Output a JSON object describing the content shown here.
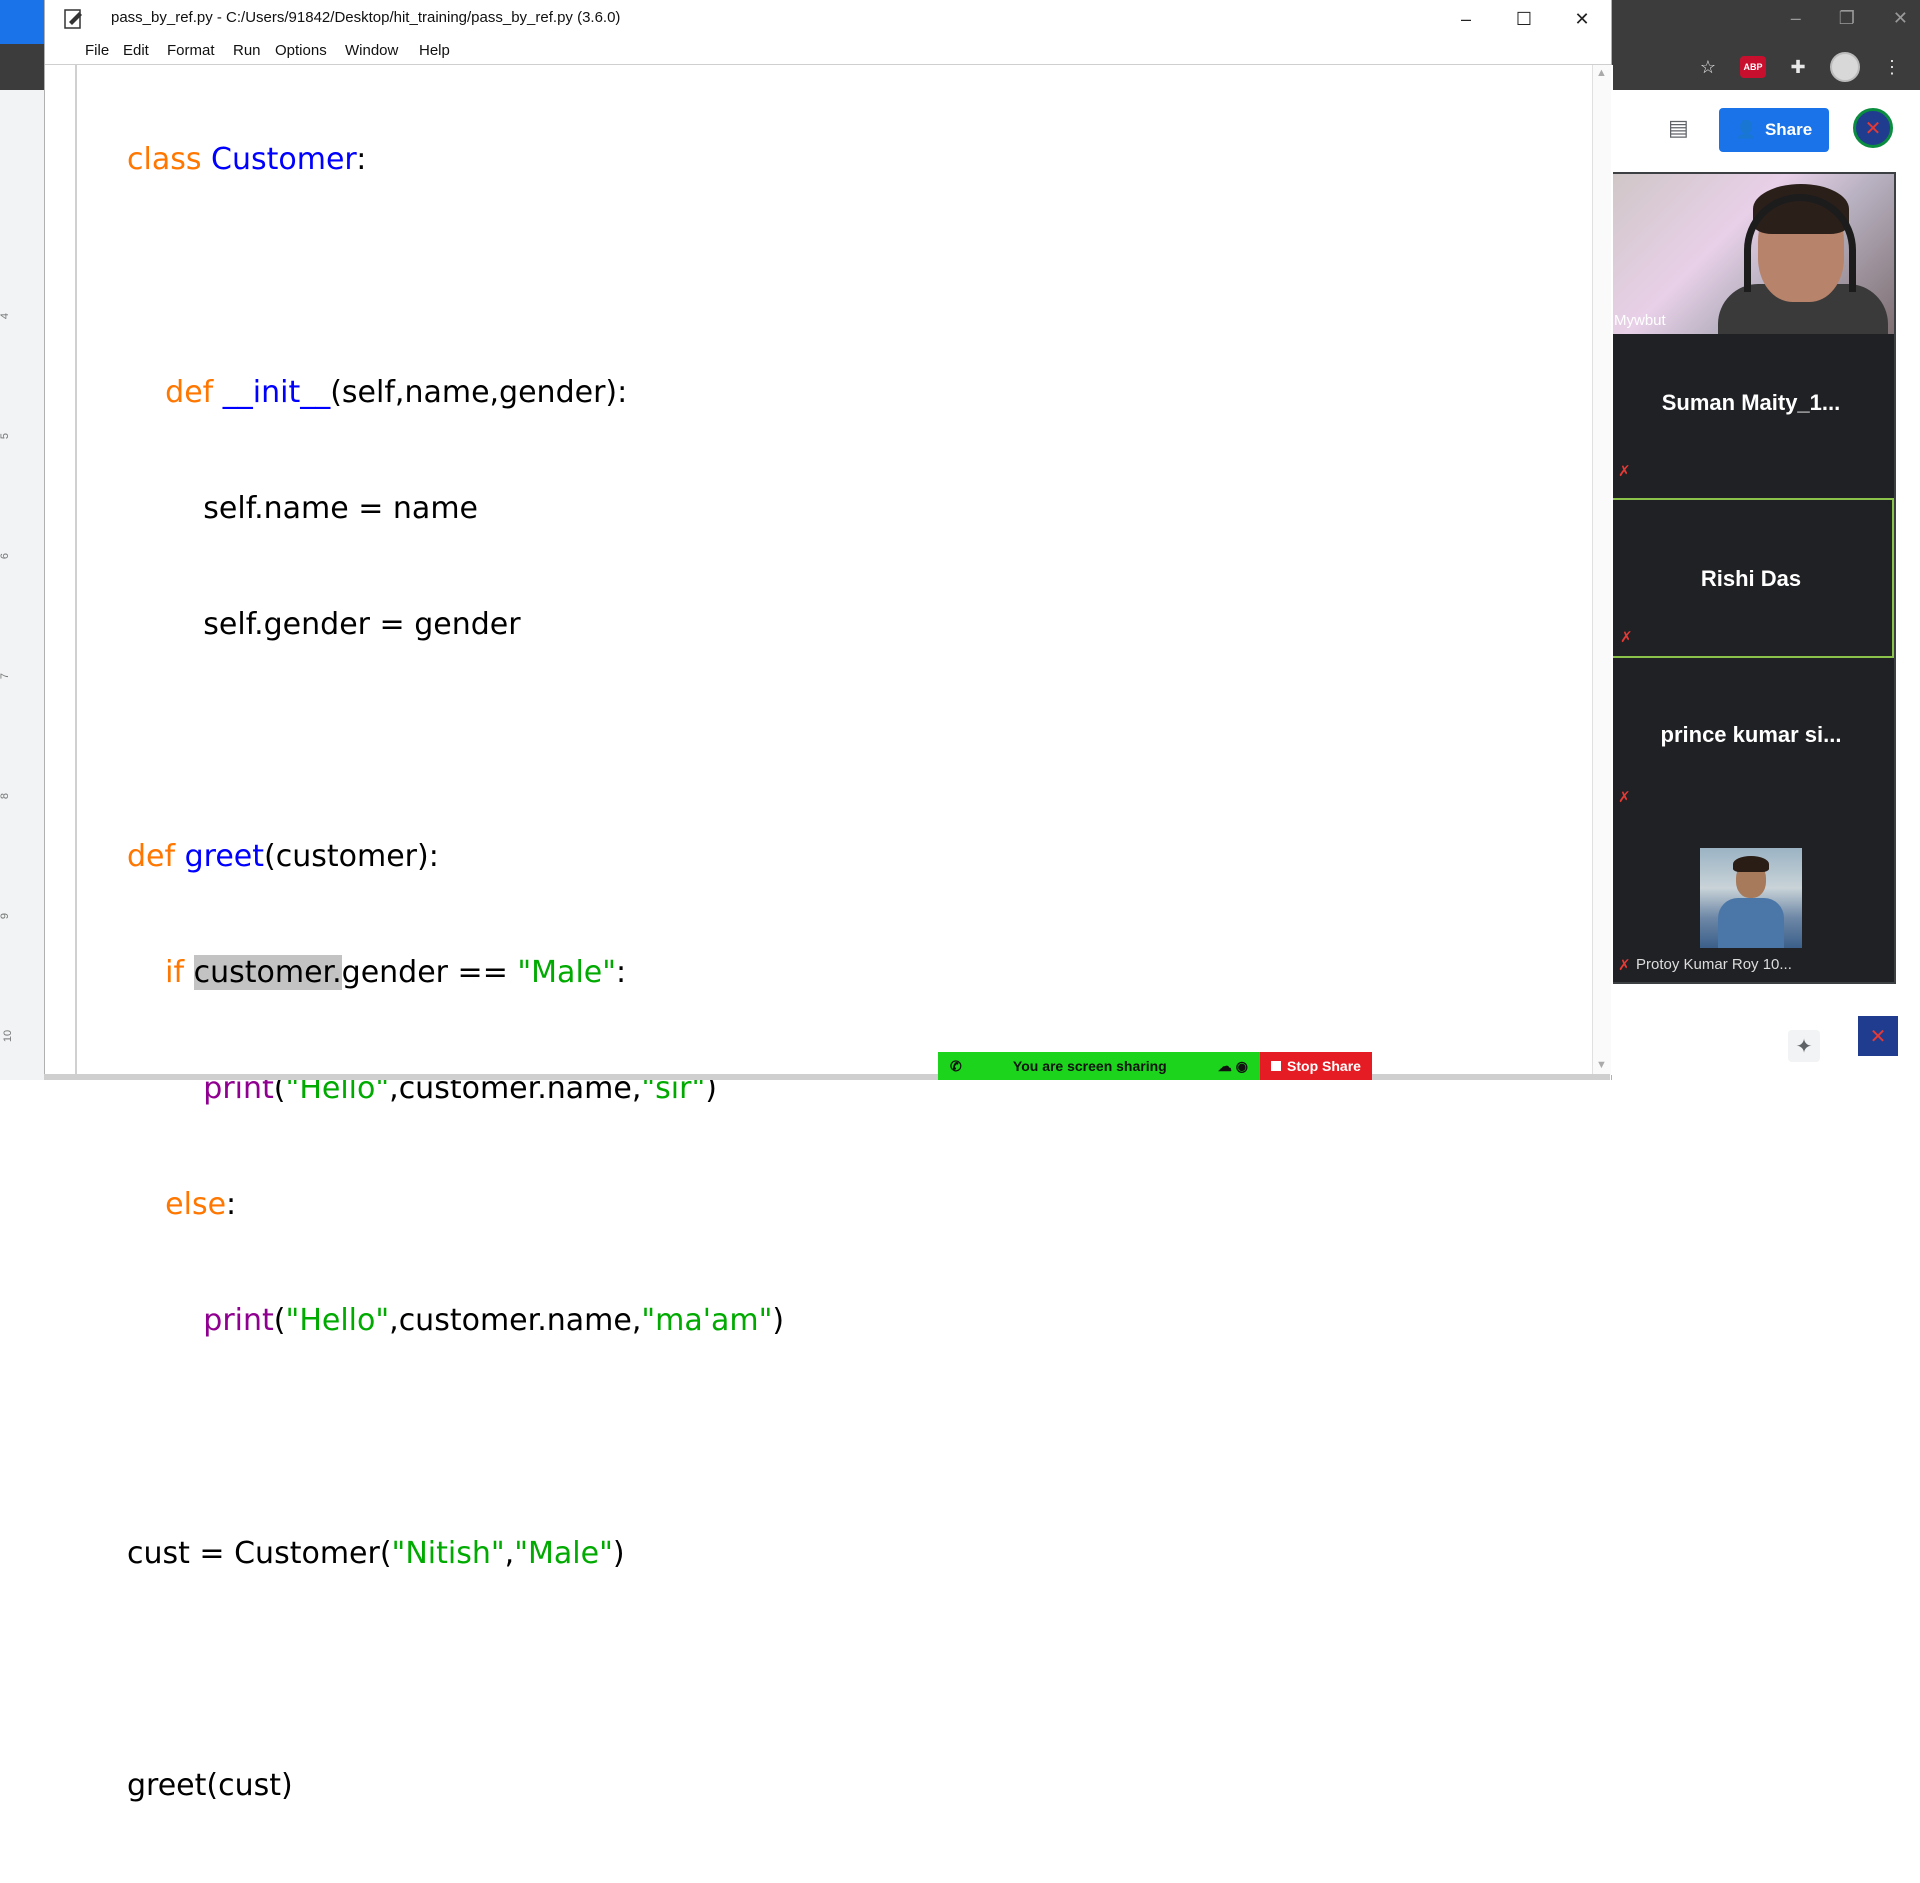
{
  "window": {
    "title": "pass_by_ref.py - C:/Users/91842/Desktop/hit_training/pass_by_ref.py (3.6.0)",
    "minimize": "–",
    "maximize": "☐",
    "close": "✕"
  },
  "menu": [
    "File",
    "Edit",
    "Format",
    "Run",
    "Options",
    "Window",
    "Help"
  ],
  "code": {
    "l1": {
      "kw": "class",
      "name": "Customer",
      "rest": ":"
    },
    "l3": {
      "kw": "def",
      "name": "__init__",
      "rest": "(self,name,gender):"
    },
    "l4": "self.name = name",
    "l5": "self.gender = gender",
    "l7": {
      "kw": "def",
      "name": "greet",
      "rest": "(customer):"
    },
    "l8": {
      "kw": "if",
      "sel": "customer.",
      "rest": "gender == ",
      "str": "\"Male\"",
      "end": ":"
    },
    "l9": {
      "fn": "print",
      "p1": "(",
      "s1": "\"Hello\"",
      "mid": ",customer.name,",
      "s2": "\"sir\"",
      "end": ")"
    },
    "l10": {
      "kw": "else",
      "end": ":"
    },
    "l11": {
      "fn": "print",
      "p1": "(",
      "s1": "\"Hello\"",
      "mid": ",customer.name,",
      "s2": "\"ma'am\"",
      "end": ")"
    },
    "l13": {
      "pre": "cust = Customer(",
      "s1": "\"Nitish\"",
      "mid": ",",
      "s2": "\"Male\"",
      "end": ")"
    },
    "l15": "greet(cust)"
  },
  "meet": {
    "share_label": "Share",
    "participants": [
      {
        "name": "Mywbut",
        "type": "video"
      },
      {
        "name": "Suman  Maity_1...",
        "type": "name"
      },
      {
        "name": "Rishi Das",
        "type": "name",
        "active_speaker": true
      },
      {
        "name": "prince kumar si...",
        "type": "name"
      },
      {
        "name": "Protoy Kumar Roy 10...",
        "type": "photo"
      }
    ]
  },
  "screen_share": {
    "status": "You are screen sharing",
    "stop_label": "Stop Share"
  },
  "ruler_ticks": [
    "4",
    "5",
    "6",
    "7",
    "8",
    "9",
    "10"
  ],
  "browser": {
    "abp": "ABP"
  },
  "colors": {
    "keyword": "#ff7700",
    "definition": "#0000ff",
    "string": "#00aa00",
    "builtin": "#900090",
    "share_button": "#1a73e8",
    "share_bar": "#1bd41b",
    "stop_share": "#e51c23"
  }
}
